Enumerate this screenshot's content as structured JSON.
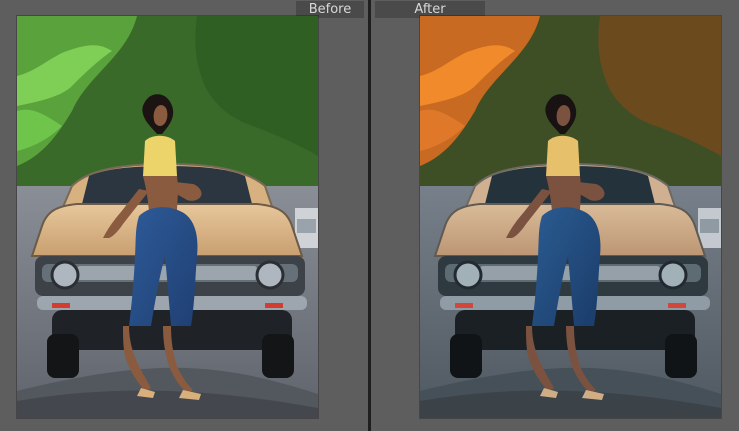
{
  "view": {
    "before_label": "Before",
    "after_label": "After"
  },
  "colors": {
    "workspace_bg": "#5e5e5e",
    "label_bg": "#4a4a4a",
    "divider": "#1f1f1f",
    "before_foliage": "#3f7f25",
    "after_foliage": "#c86a22",
    "before_car_paint": "#d9b588",
    "after_car_paint": "#d3b08e",
    "jeans": "#2f5c9a"
  },
  "icons": {
    "photo_before": "photo",
    "photo_after": "photo"
  }
}
